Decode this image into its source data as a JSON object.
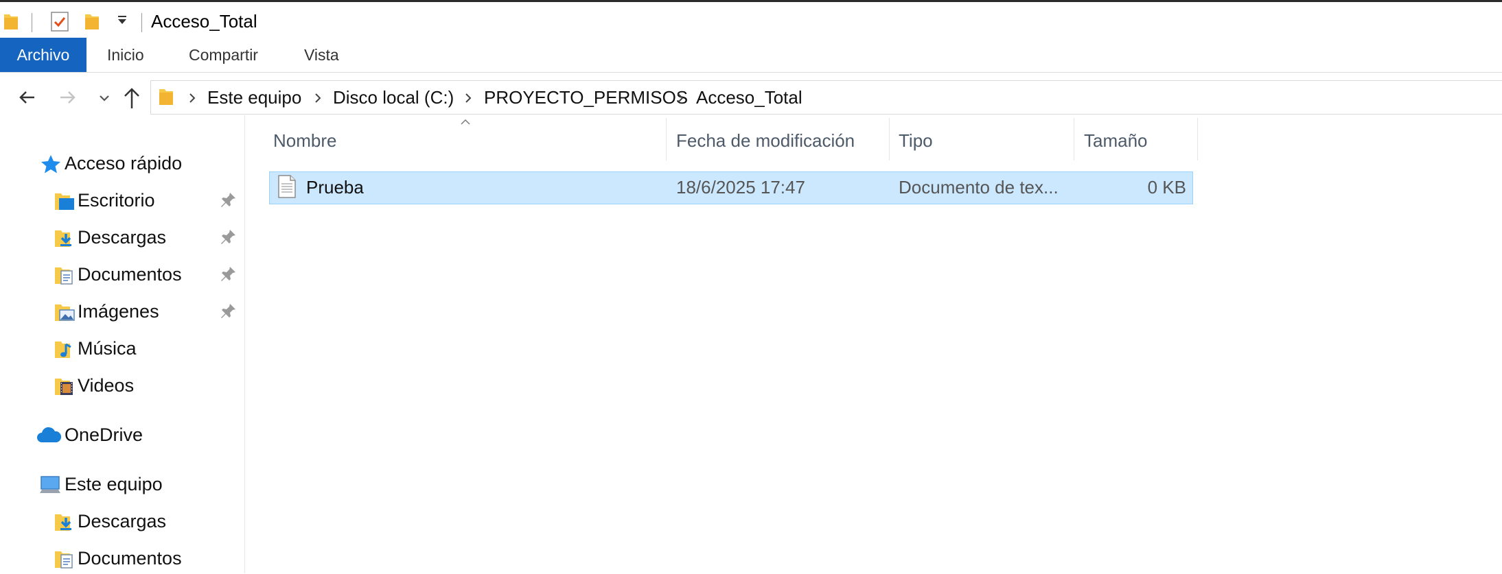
{
  "window": {
    "title": "Acceso_Total"
  },
  "ribbon": {
    "tabs": [
      "Archivo",
      "Inicio",
      "Compartir",
      "Vista"
    ]
  },
  "address": {
    "crumbs": [
      "Este equipo",
      "Disco local (C:)",
      "PROYECTO_PERMISOS",
      "Acceso_Total"
    ]
  },
  "nav": {
    "quick_access": "Acceso rápido",
    "quick_items": [
      "Escritorio",
      "Descargas",
      "Documentos",
      "Imágenes",
      "Música",
      "Videos"
    ],
    "onedrive": "OneDrive",
    "this_pc": "Este equipo",
    "pc_items": [
      "Descargas",
      "Documentos"
    ]
  },
  "columns": {
    "name": "Nombre",
    "modified": "Fecha de modificación",
    "type": "Tipo",
    "size": "Tamaño"
  },
  "files": [
    {
      "name": "Prueba",
      "modified": "18/6/2025 17:47",
      "type": "Documento de tex...",
      "size": "0 KB"
    }
  ],
  "colors": {
    "accent": "#1565c0",
    "selection": "#cce8ff",
    "selection_border": "#99d1ff",
    "folder": "#f7c948"
  }
}
